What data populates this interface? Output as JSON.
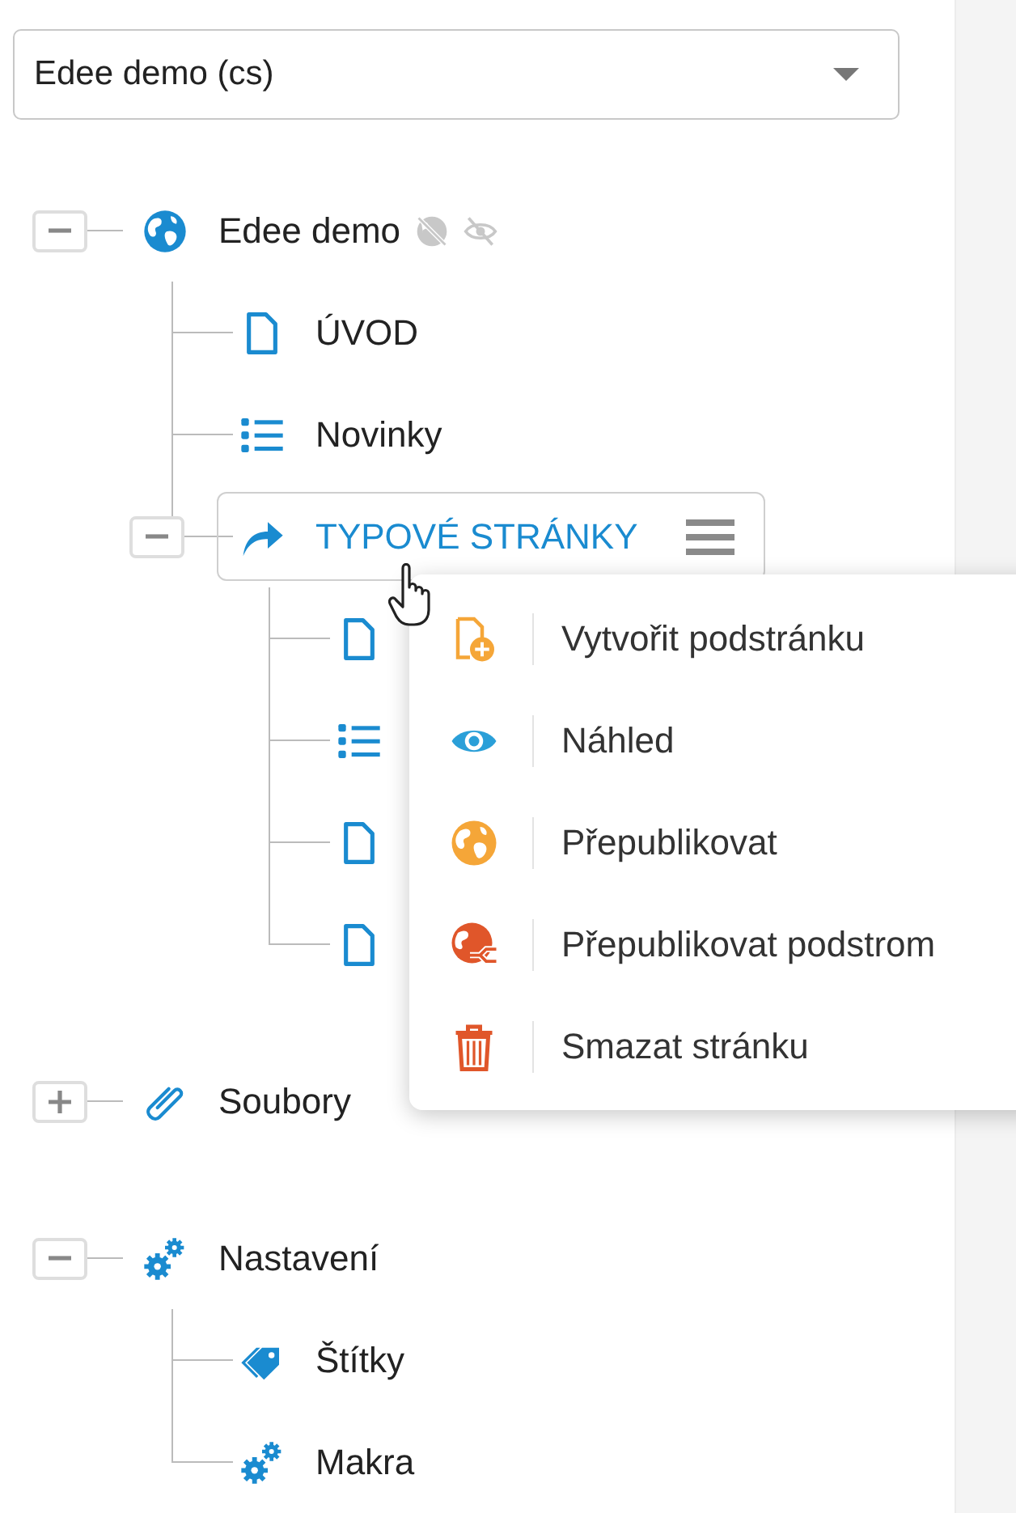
{
  "dropdown": {
    "value": "Edee demo (cs)"
  },
  "tree": [
    {
      "kind": "globe",
      "label": "Edee demo",
      "expanded": true,
      "selected": false,
      "badges": [
        {
          "kind": "globe-off"
        },
        {
          "kind": "eye-off"
        }
      ],
      "children": [
        {
          "kind": "page",
          "label": "ÚVOD",
          "selected": false
        },
        {
          "kind": "list",
          "label": "Novinky",
          "selected": false
        },
        {
          "kind": "redirect",
          "label": "TYPOVÉ STRÁNKY",
          "expanded": true,
          "selected": true,
          "children": [
            {
              "kind": "page",
              "selected": false
            },
            {
              "kind": "list",
              "selected": false
            },
            {
              "kind": "page",
              "selected": false
            },
            {
              "kind": "page",
              "selected": false
            }
          ]
        }
      ]
    },
    {
      "kind": "paperclip",
      "label": "Soubory",
      "expanded": false,
      "selected": false
    },
    {
      "kind": "gears",
      "label": "Nastavení",
      "expanded": true,
      "selected": false,
      "children": [
        {
          "kind": "tag",
          "label": "Štítky",
          "selected": false
        },
        {
          "kind": "gears",
          "label": "Makra",
          "selected": false
        }
      ]
    }
  ],
  "context_menu": {
    "items": [
      {
        "kind": "page-add",
        "label": "Vytvořit podstránku"
      },
      {
        "kind": "eye",
        "label": "Náhled"
      },
      {
        "kind": "globe",
        "label": "Přepublikovat"
      },
      {
        "kind": "globe-tree",
        "label": "Přepublikovat podstrom"
      },
      {
        "kind": "trash",
        "label": "Smazat stránku"
      }
    ]
  }
}
